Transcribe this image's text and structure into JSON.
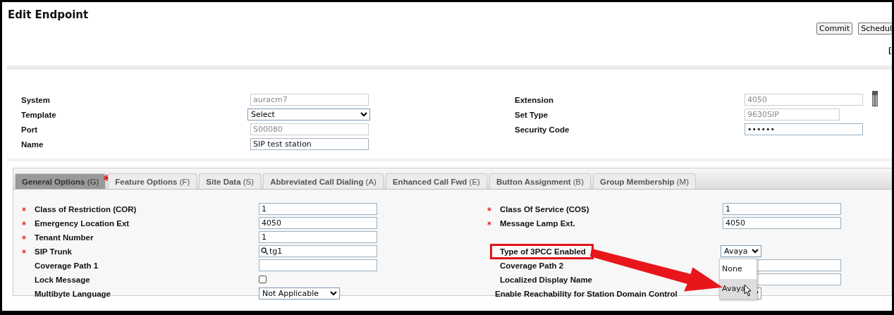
{
  "page": {
    "title": "Edit Endpoint"
  },
  "actions": [
    {
      "label": "Commit"
    },
    {
      "label": "Schedul"
    }
  ],
  "edge_mark": "[",
  "endpoint": {
    "left": [
      {
        "label": "System",
        "kind": "readonly",
        "value": "auracm7"
      },
      {
        "label": "Template",
        "kind": "select",
        "value": "Select"
      },
      {
        "label": "Port",
        "kind": "readonly",
        "value": "S00080"
      },
      {
        "label": "Name",
        "kind": "text",
        "value": "SIP test station"
      }
    ],
    "right": [
      {
        "label": "Extension",
        "kind": "readonly",
        "value": "4050"
      },
      {
        "label": "Set Type",
        "kind": "readonly",
        "value": "9630SIP"
      },
      {
        "label": "Security Code",
        "kind": "text",
        "value": "••••••"
      }
    ]
  },
  "tabs": [
    {
      "label": "General Options",
      "key": "(G)",
      "selected": true,
      "required": true
    },
    {
      "label": "Feature Options",
      "key": "(F)",
      "selected": false,
      "required": false
    },
    {
      "label": "Site Data",
      "key": "(S)",
      "selected": false,
      "required": false
    },
    {
      "label": "Abbreviated Call Dialing",
      "key": "(A)",
      "selected": false,
      "required": false
    },
    {
      "label": "Enhanced Call Fwd",
      "key": "(E)",
      "selected": false,
      "required": false
    },
    {
      "label": "Button Assignment",
      "key": "(B)",
      "selected": false,
      "required": false
    },
    {
      "label": "Group Membership",
      "key": "(M)",
      "selected": false,
      "required": false
    }
  ],
  "general_options": {
    "left": [
      {
        "label": "Class of Restriction (COR)",
        "required": true,
        "kind": "text",
        "value": "1"
      },
      {
        "label": "Emergency Location Ext",
        "required": true,
        "kind": "text",
        "value": "4050"
      },
      {
        "label": "Tenant Number",
        "required": true,
        "kind": "text",
        "value": "1"
      },
      {
        "label": "SIP Trunk",
        "required": true,
        "kind": "search",
        "value": "tg1"
      },
      {
        "label": "Coverage Path 1",
        "required": false,
        "kind": "text"
      },
      {
        "label": "Lock Message",
        "required": false,
        "kind": "checkbox",
        "checked": false
      },
      {
        "label": "Multibyte Language",
        "required": false,
        "kind": "select",
        "value": "Not Applicable"
      }
    ],
    "right": [
      {
        "label": "Class Of Service (COS)",
        "required": true,
        "kind": "text",
        "value": "1"
      },
      {
        "label": "Message Lamp Ext.",
        "required": true,
        "kind": "text",
        "value": "4050"
      },
      {
        "kind": "blank"
      },
      {
        "label": "Type of 3PCC Enabled",
        "required": false,
        "kind": "smallselect",
        "value": "Avaya",
        "highlighted": true
      },
      {
        "label": "Coverage Path 2",
        "required": false,
        "kind": "text"
      },
      {
        "label": "Localized Display Name",
        "required": false,
        "kind": "text"
      },
      {
        "label": "Enable Reachability for Station Domain Control",
        "required": false,
        "kind": "hiddenselect"
      }
    ]
  },
  "dropdown": {
    "options": [
      {
        "label": "None",
        "selected": false
      },
      {
        "label": "Avaya",
        "selected": true
      }
    ]
  }
}
